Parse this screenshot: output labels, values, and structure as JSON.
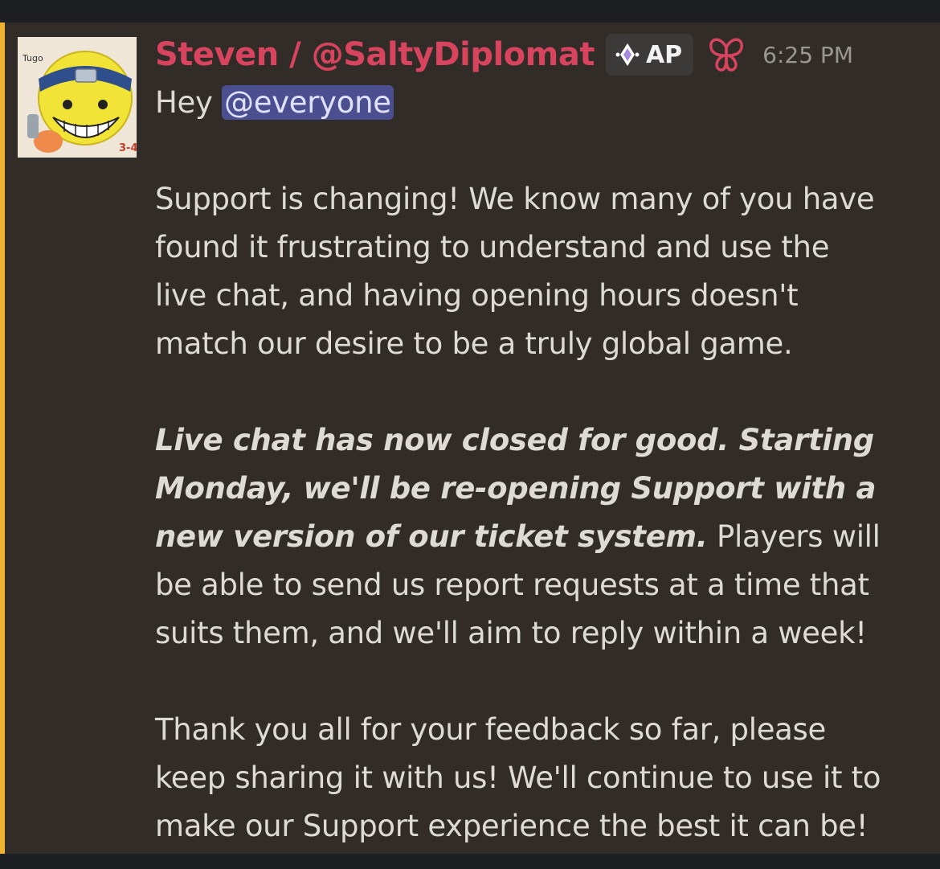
{
  "message": {
    "author": "Steven / @SaltyDiplomat",
    "tag": {
      "icon": "diamond-sparkle-icon",
      "label": "AP"
    },
    "role_icon": "butterfly-icon",
    "timestamp": "6:25 PM",
    "greeting": "Hey ",
    "mention": "@everyone",
    "paragraph1": [
      "Support is changing! We know many of you have",
      "found it frustrating to understand and use the",
      "live chat, and having opening hours doesn't",
      "match our desire to be a truly global game."
    ],
    "paragraph2": {
      "bold_italic": [
        "Live chat has now closed for good. Starting",
        "Monday, we'll be re-opening Support with a",
        "new version of our ticket system."
      ],
      "tail_first": " Players will",
      "rest": [
        "be able to send us report requests at a time that",
        "suits them, and we'll aim to reply within a week!"
      ]
    },
    "paragraph3": [
      "Thank you all for your feedback so far, please",
      "keep sharing it with us! We'll continue to use it to",
      "make our Support experience the best it can be!"
    ]
  },
  "colors": {
    "username": "#d8435e",
    "mention_bar": "#f0b232",
    "mention_bg": "#4b4e8f",
    "message_bg": "#312c28",
    "text": "#dedbd6"
  }
}
